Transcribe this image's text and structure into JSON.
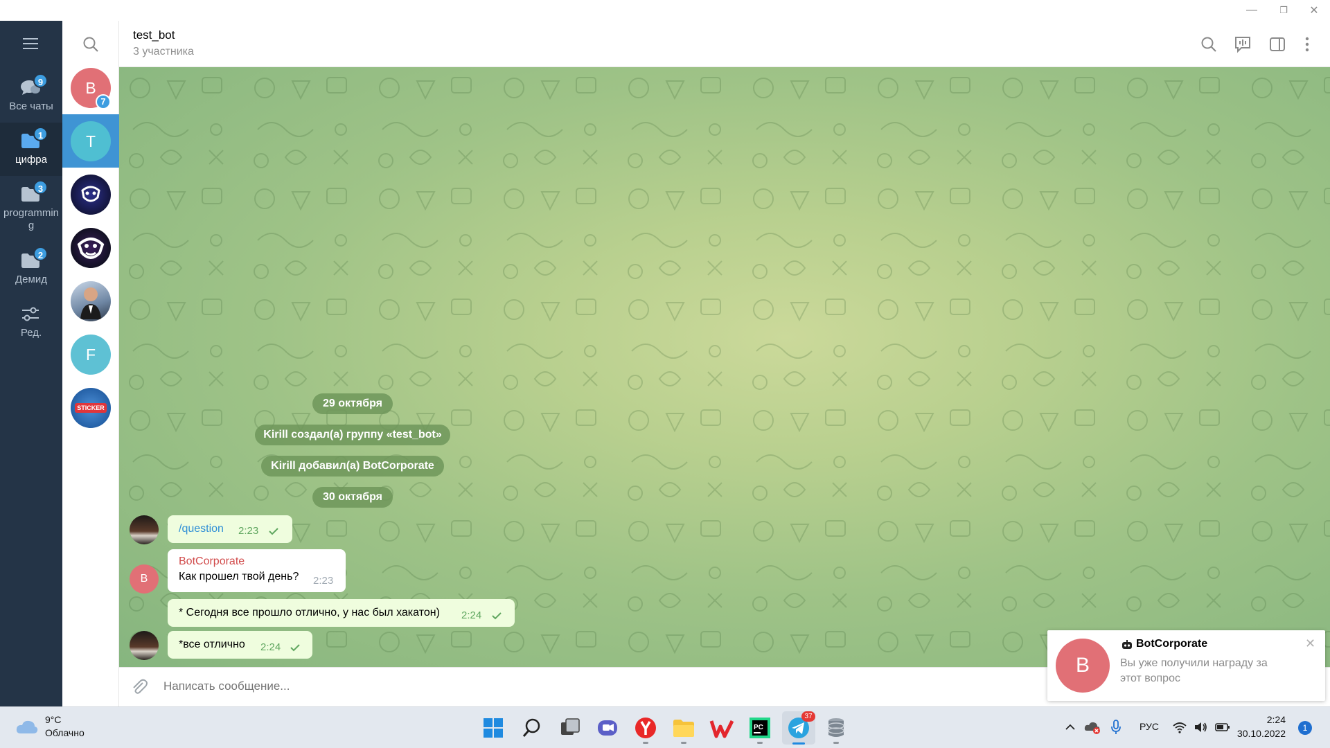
{
  "window": {
    "controls": [
      "—",
      "❐",
      "✕"
    ]
  },
  "folders": [
    {
      "label": "Все чаты",
      "badge": "9",
      "icon": "chats-icon",
      "active": false
    },
    {
      "label": "цифра",
      "badge": "1",
      "icon": "folder-icon",
      "active": true
    },
    {
      "label": "programming",
      "badge": "3",
      "icon": "folder-icon",
      "active": false
    },
    {
      "label": "Демид",
      "badge": "2",
      "icon": "folder-icon",
      "active": false
    },
    {
      "label": "Ред.",
      "badge": "",
      "icon": "sliders-icon",
      "active": false
    }
  ],
  "chat_list": [
    {
      "letter": "B",
      "badge": "7",
      "color": "#e17076"
    },
    {
      "letter": "T",
      "badge": "",
      "color": "#4fbfd2"
    },
    {
      "letter": "",
      "badge": "",
      "color": "#1a1f5e"
    },
    {
      "letter": "",
      "badge": "",
      "color": "#161832"
    },
    {
      "letter": "",
      "badge": "",
      "color": "#8aa0b8"
    },
    {
      "letter": "F",
      "badge": "",
      "color": "#5ec1d4"
    },
    {
      "letter": "STICKER",
      "badge": "",
      "color": "#2d6fb8"
    }
  ],
  "header": {
    "title": "test_bot",
    "subtitle": "3 участника"
  },
  "service": {
    "date1": "29 октября",
    "event1": "Kirill создал(а) группу «test_bot»",
    "event2": "Kirill добавил(а) BotCorporate",
    "date2": "30 октября"
  },
  "messages": [
    {
      "text": "/question",
      "time": "2:23",
      "direction": "out"
    },
    {
      "sender": "BotCorporate",
      "sender_initial": "B",
      "text": "Как прошел твой день?",
      "time": "2:23",
      "direction": "in"
    },
    {
      "text": "* Сегодня все прошло отлично, у нас был хакатон)",
      "time": "2:24",
      "direction": "out"
    },
    {
      "text": "*все отлично",
      "time": "2:24",
      "direction": "out"
    }
  ],
  "compose": {
    "placeholder": "Написать сообщение..."
  },
  "notification": {
    "avatar_letter": "B",
    "title": "BotCorporate",
    "text": "Вы уже получили награду за этот вопрос"
  },
  "taskbar": {
    "weather_temp": "9°C",
    "weather_desc": "Облачно",
    "telegram_badge": "37",
    "lang": "РУС",
    "time": "2:24",
    "date": "30.10.2022",
    "notif_count": "1"
  },
  "colors": {
    "sidebar_bg": "#243447",
    "accent": "#3f94d4",
    "out_bubble": "#effdde",
    "sender_name": "#d14b4b"
  }
}
